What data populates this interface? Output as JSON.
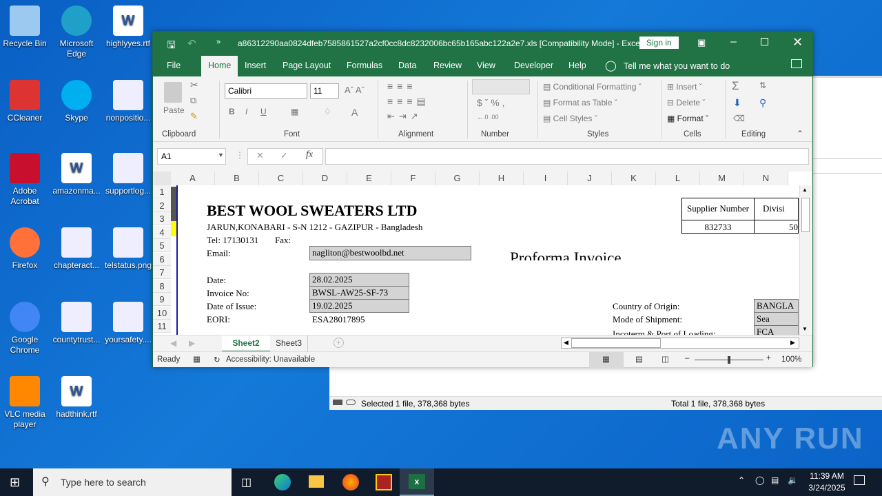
{
  "desktop": {
    "icons": [
      {
        "label": "Recycle Bin",
        "icon": "recycle-bin-icon"
      },
      {
        "label": "Microsoft Edge",
        "icon": "edge-icon"
      },
      {
        "label": "highlyyes.rtf",
        "icon": "word-doc-icon"
      },
      {
        "label": "CCleaner",
        "icon": "ccleaner-icon"
      },
      {
        "label": "Skype",
        "icon": "skype-icon"
      },
      {
        "label": "nonpositio...",
        "icon": "image-file-icon"
      },
      {
        "label": "Adobe Acrobat",
        "icon": "acrobat-icon"
      },
      {
        "label": "amazonma...",
        "icon": "word-doc-icon"
      },
      {
        "label": "supportlog...",
        "icon": "image-file-icon"
      },
      {
        "label": "Firefox",
        "icon": "firefox-icon"
      },
      {
        "label": "chapteract...",
        "icon": "image-file-icon"
      },
      {
        "label": "telstatus.png",
        "icon": "image-file-icon"
      },
      {
        "label": "Google Chrome",
        "icon": "chrome-icon"
      },
      {
        "label": "countytrust...",
        "icon": "image-file-icon"
      },
      {
        "label": "yoursafety....",
        "icon": "image-file-icon"
      },
      {
        "label": "VLC media player",
        "icon": "vlc-icon"
      },
      {
        "label": "hadthink.rtf",
        "icon": "word-doc-icon"
      }
    ]
  },
  "explorer": {
    "status_selected": "Selected 1 file, 378,368 bytes",
    "status_total": "Total 1 file, 378,368 bytes"
  },
  "excel": {
    "title": "a86312290aa0824dfeb7585861527a2cf0cc8dc8232006bc65b165abc122a2e7.xls  [Compatibility Mode]  -  Excel",
    "sign_in": "Sign in",
    "tabs": [
      "File",
      "Home",
      "Insert",
      "Page Layout",
      "Formulas",
      "Data",
      "Review",
      "View",
      "Developer",
      "Help"
    ],
    "active_tab": "Home",
    "tell_me": "Tell me what you want to do",
    "ribbon": {
      "paste": "Paste",
      "font_name": "Calibri",
      "font_size": "11",
      "conditional_formatting": "Conditional Formatting",
      "format_as_table": "Format as Table",
      "cell_styles": "Cell Styles",
      "insert": "Insert",
      "delete": "Delete",
      "format": "Format",
      "groups": [
        "Clipboard",
        "Font",
        "Alignment",
        "Number",
        "Styles",
        "Cells",
        "Editing"
      ]
    },
    "name_box": "A1",
    "formula": "",
    "columns": [
      "A",
      "B",
      "C",
      "D",
      "E",
      "F",
      "G",
      "H",
      "I",
      "J",
      "K",
      "L",
      "M",
      "N"
    ],
    "rows": [
      "1",
      "2",
      "3",
      "4",
      "5",
      "6",
      "7",
      "8",
      "9",
      "10",
      "11"
    ],
    "sheet": {
      "company": "BEST WOOL SWEATERS LTD",
      "address": "JARUN,KONABARI - S-N 1212 - GAZIPUR  - Bangladesh",
      "tel": "Tel: 17130131",
      "fax": "Fax:",
      "email_label": "Email:",
      "email": "nagliton@bestwoolbd.net",
      "doc_title": "Proforma Invoice",
      "date_label": "Date:",
      "date": "28.02.2025",
      "invoice_label": "Invoice No:",
      "invoice": "BWSL-AW25-SF-73",
      "issue_label": "Date of Issue:",
      "issue": "19.02.2025",
      "eori_label": "EORI:",
      "eori": "ESA28017895",
      "supplier_header": "Supplier Number",
      "division_header": "Divisi",
      "supplier_number": "832733",
      "division": "50",
      "origin_label": "Country of Origin:",
      "origin": "BANGLA",
      "shipment_label": "Mode of Shipment:",
      "shipment": "Sea",
      "incoterm_label": "Incoterm & Port of Loading:",
      "incoterm": "FCA"
    },
    "sheet_tabs": [
      "Sheet2",
      "Sheet3"
    ],
    "active_sheet": "Sheet2",
    "status_ready": "Ready",
    "accessibility": "Accessibility: Unavailable",
    "zoom": "100%"
  },
  "taskbar": {
    "search_placeholder": "Type here to search",
    "time": "11:39 AM",
    "date": "3/24/2025"
  },
  "watermark": "ANY RUN"
}
